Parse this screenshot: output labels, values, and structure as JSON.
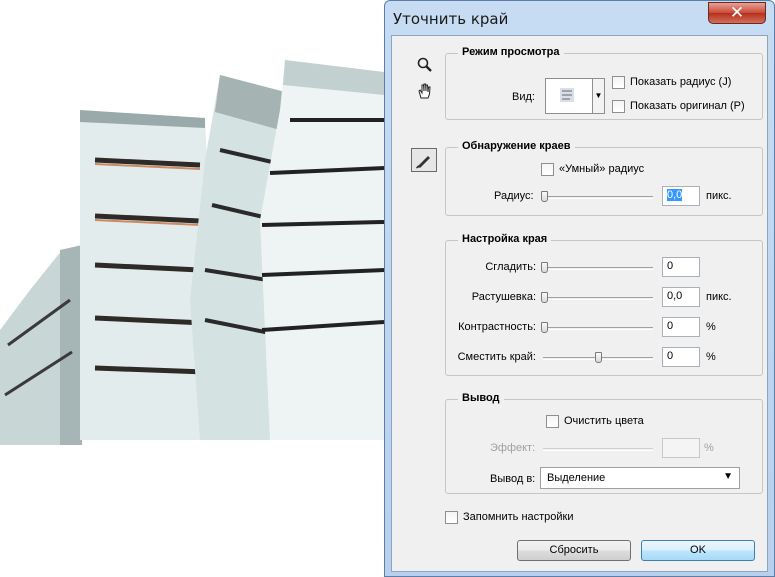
{
  "dialog": {
    "title": "Уточнить край",
    "close_symbol": "✕"
  },
  "tools": {
    "zoom_icon": "zoom-icon",
    "hand_icon": "hand-icon",
    "refine_brush_icon": "refine-radius-brush-icon"
  },
  "view_mode": {
    "legend": "Режим просмотра",
    "view_label": "Вид:",
    "show_radius_label": "Показать радиус (J)",
    "show_original_label": "Показать оригинал (P)"
  },
  "edge_detection": {
    "legend": "Обнаружение краев",
    "smart_radius_label": "«Умный» радиус",
    "radius_label": "Радиус:",
    "radius_value": "0,0",
    "radius_unit": "пикс."
  },
  "adjust_edge": {
    "legend": "Настройка края",
    "smooth_label": "Сгладить:",
    "smooth_value": "0",
    "feather_label": "Растушевка:",
    "feather_value": "0,0",
    "feather_unit": "пикс.",
    "contrast_label": "Контрастность:",
    "contrast_value": "0",
    "contrast_unit": "%",
    "shift_label": "Сместить край:",
    "shift_value": "0",
    "shift_unit": "%"
  },
  "output": {
    "legend": "Вывод",
    "decontaminate_label": "Очистить цвета",
    "amount_label": "Эффект:",
    "amount_unit": "%",
    "output_to_label": "Вывод в:",
    "output_to_value": "Выделение"
  },
  "remember_label": "Запомнить настройки",
  "reset_label": "Сбросить",
  "ok_label": "OK"
}
